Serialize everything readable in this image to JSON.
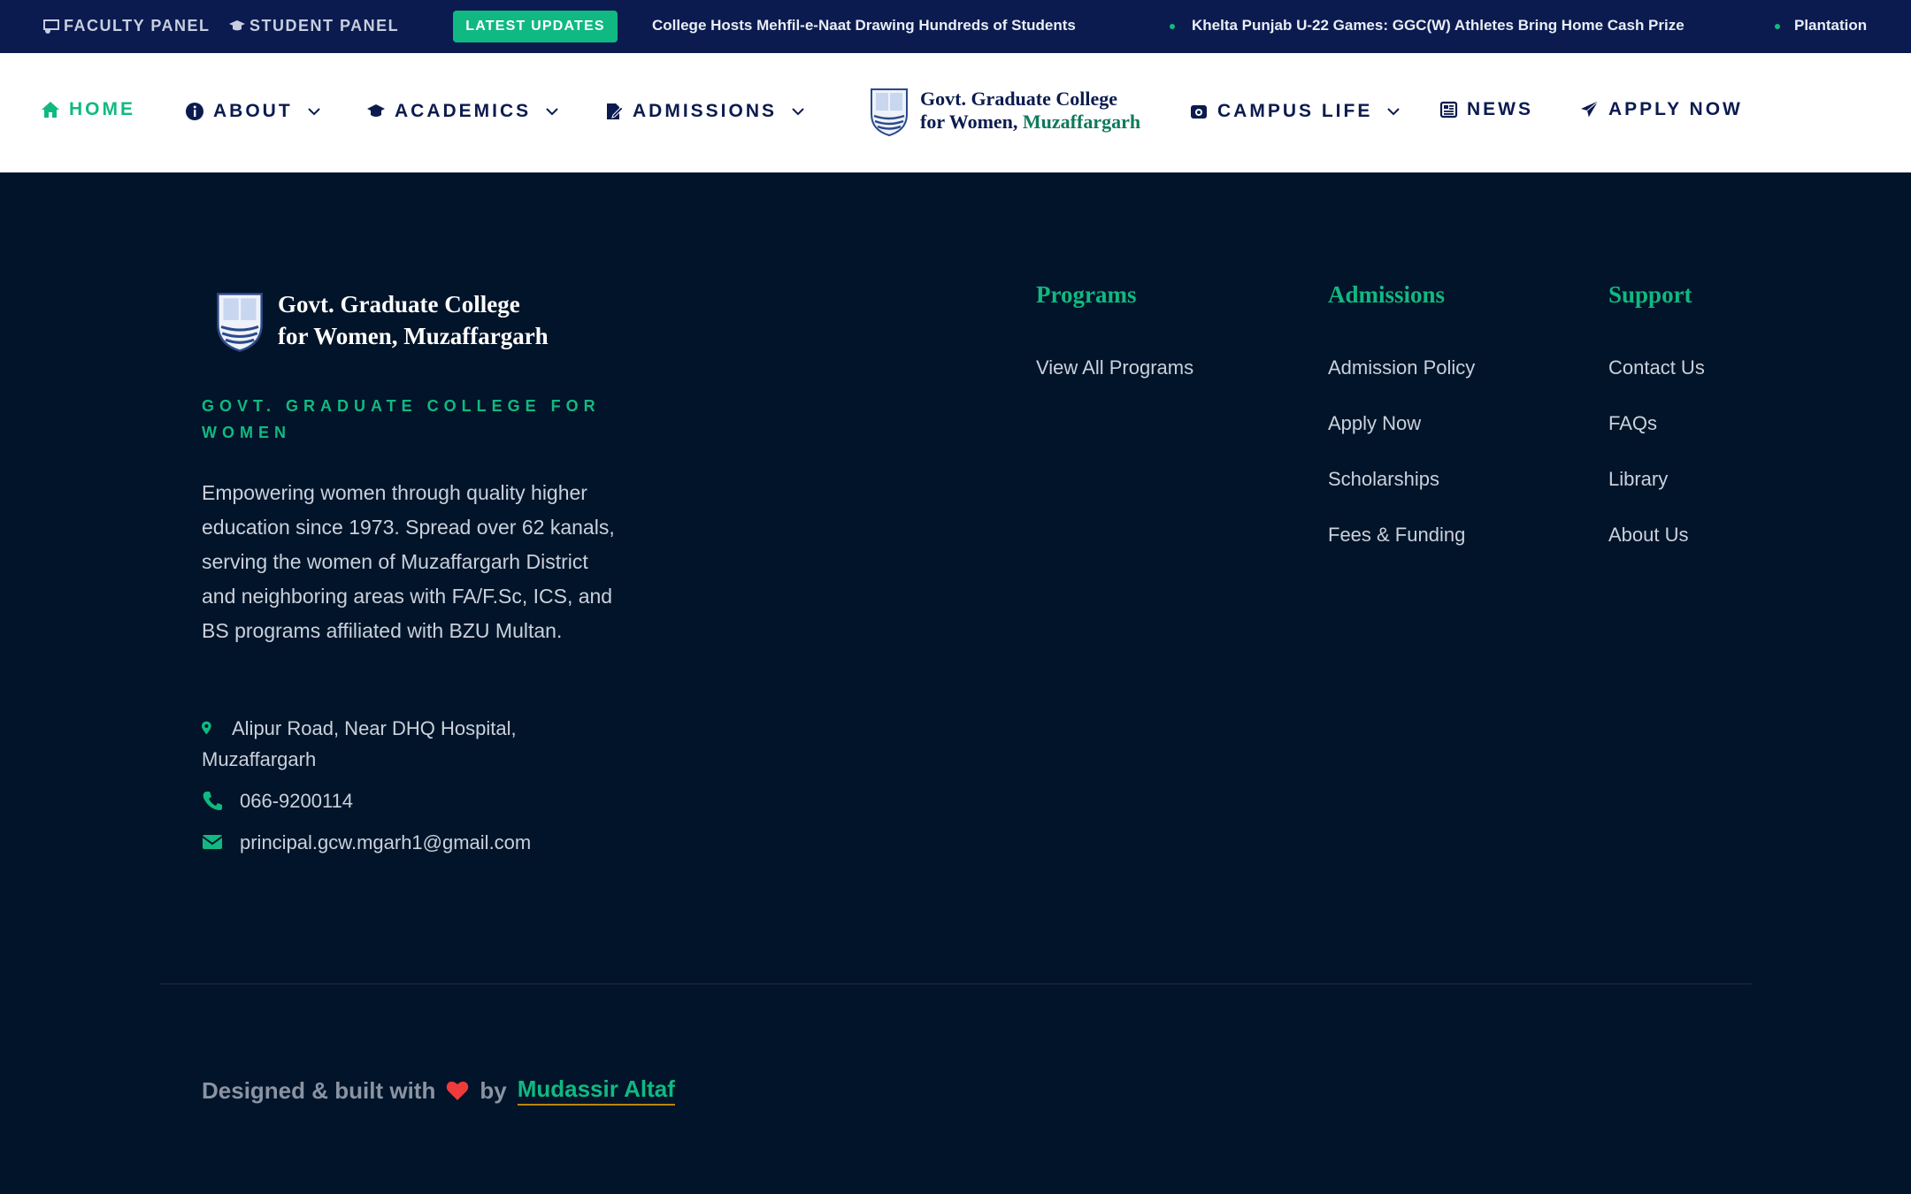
{
  "topbar": {
    "faculty_panel": "FACULTY PANEL",
    "student_panel": "STUDENT PANEL",
    "latest_updates": "LATEST UPDATES",
    "ticker": [
      "College Hosts Mehfil-e-Naat Drawing Hundreds of Students",
      "Khelta Punjab U-22 Games: GGC(W) Athletes Bring Home Cash Prize",
      "Plantation"
    ]
  },
  "nav": {
    "home": "HOME",
    "about": "ABOUT",
    "academics": "ACADEMICS",
    "admissions": "ADMISSIONS",
    "logo_line1": "Govt. Graduate College",
    "logo_line2a": "for Women, ",
    "logo_line2b": "Muzaffargarh",
    "campus_life": "CAMPUS LIFE",
    "news": "NEWS",
    "apply_now": "APPLY NOW"
  },
  "footer": {
    "brand_line1": "Govt. Graduate College",
    "brand_line2": "for Women, Muzaffargarh",
    "tagline": "GOVT. GRADUATE COLLEGE FOR WOMEN",
    "description": "Empowering women through quality higher education since 1973. Spread over 62 kanals, serving the women of Muzaffargarh District and neighboring areas with FA/F.Sc, ICS, and BS programs affiliated with BZU Multan.",
    "address": "Alipur Road, Near DHQ Hospital, Muzaffargarh",
    "phone": "066-9200114",
    "email": "principal.gcw.mgarh1@gmail.com",
    "columns": [
      {
        "title": "Programs",
        "links": [
          "View All Programs"
        ]
      },
      {
        "title": "Admissions",
        "links": [
          "Admission Policy",
          "Apply Now",
          "Scholarships",
          "Fees & Funding"
        ]
      },
      {
        "title": "Support",
        "links": [
          "Contact Us",
          "FAQs",
          "Library",
          "About Us"
        ]
      }
    ],
    "credit_prefix": "Designed & built with",
    "credit_by": "by",
    "credit_author": "Mudassir Altaf"
  },
  "colors": {
    "navy": "#0b1b4f",
    "accent": "#10b981",
    "footer_bg": "#021429"
  }
}
